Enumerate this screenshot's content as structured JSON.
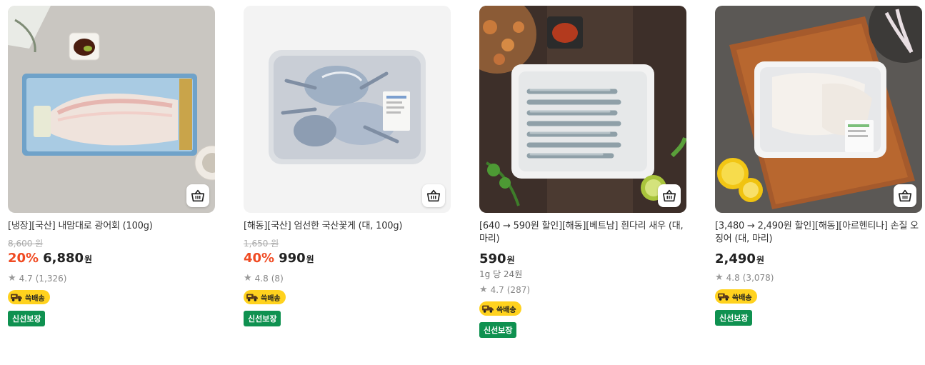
{
  "products": [
    {
      "title": "[냉장][국산] 내맘대로 광어회 (100g)",
      "original_price": "8,600 원",
      "discount": "20%",
      "price": "6,880",
      "currency": "원",
      "rating": "4.7",
      "reviews": "(1,326)",
      "shipping": "쓱배송",
      "badge": "신선보장",
      "cart_icon": "basket-icon"
    },
    {
      "title": "[해동][국산] 엄선한 국산꽃게 (대, 100g)",
      "original_price": "1,650 원",
      "discount": "40%",
      "price": "990",
      "currency": "원",
      "rating": "4.8",
      "reviews": "(8)",
      "shipping": "쓱배송",
      "badge": "신선보장",
      "cart_icon": "basket-icon"
    },
    {
      "title": "[640 → 590원 할인][해동][베트남] 흰다리 새우 (대, 마리)",
      "price": "590",
      "currency": "원",
      "unit_price": "1g 당 24원",
      "rating": "4.7",
      "reviews": "(287)",
      "shipping": "쓱배송",
      "badge": "신선보장",
      "cart_icon": "basket-icon"
    },
    {
      "title": "[3,480 → 2,490원 할인][해동][아르헨티나] 손질 오징어 (대, 마리)",
      "price": "2,490",
      "currency": "원",
      "rating": "4.8",
      "reviews": "(3,078)",
      "shipping": "쓱배송",
      "badge": "신선보장",
      "cart_icon": "basket-icon"
    }
  ],
  "colors": {
    "discount": "#f04b23",
    "shipping_badge": "#ffd21e",
    "fresh_badge": "#0f9150"
  }
}
